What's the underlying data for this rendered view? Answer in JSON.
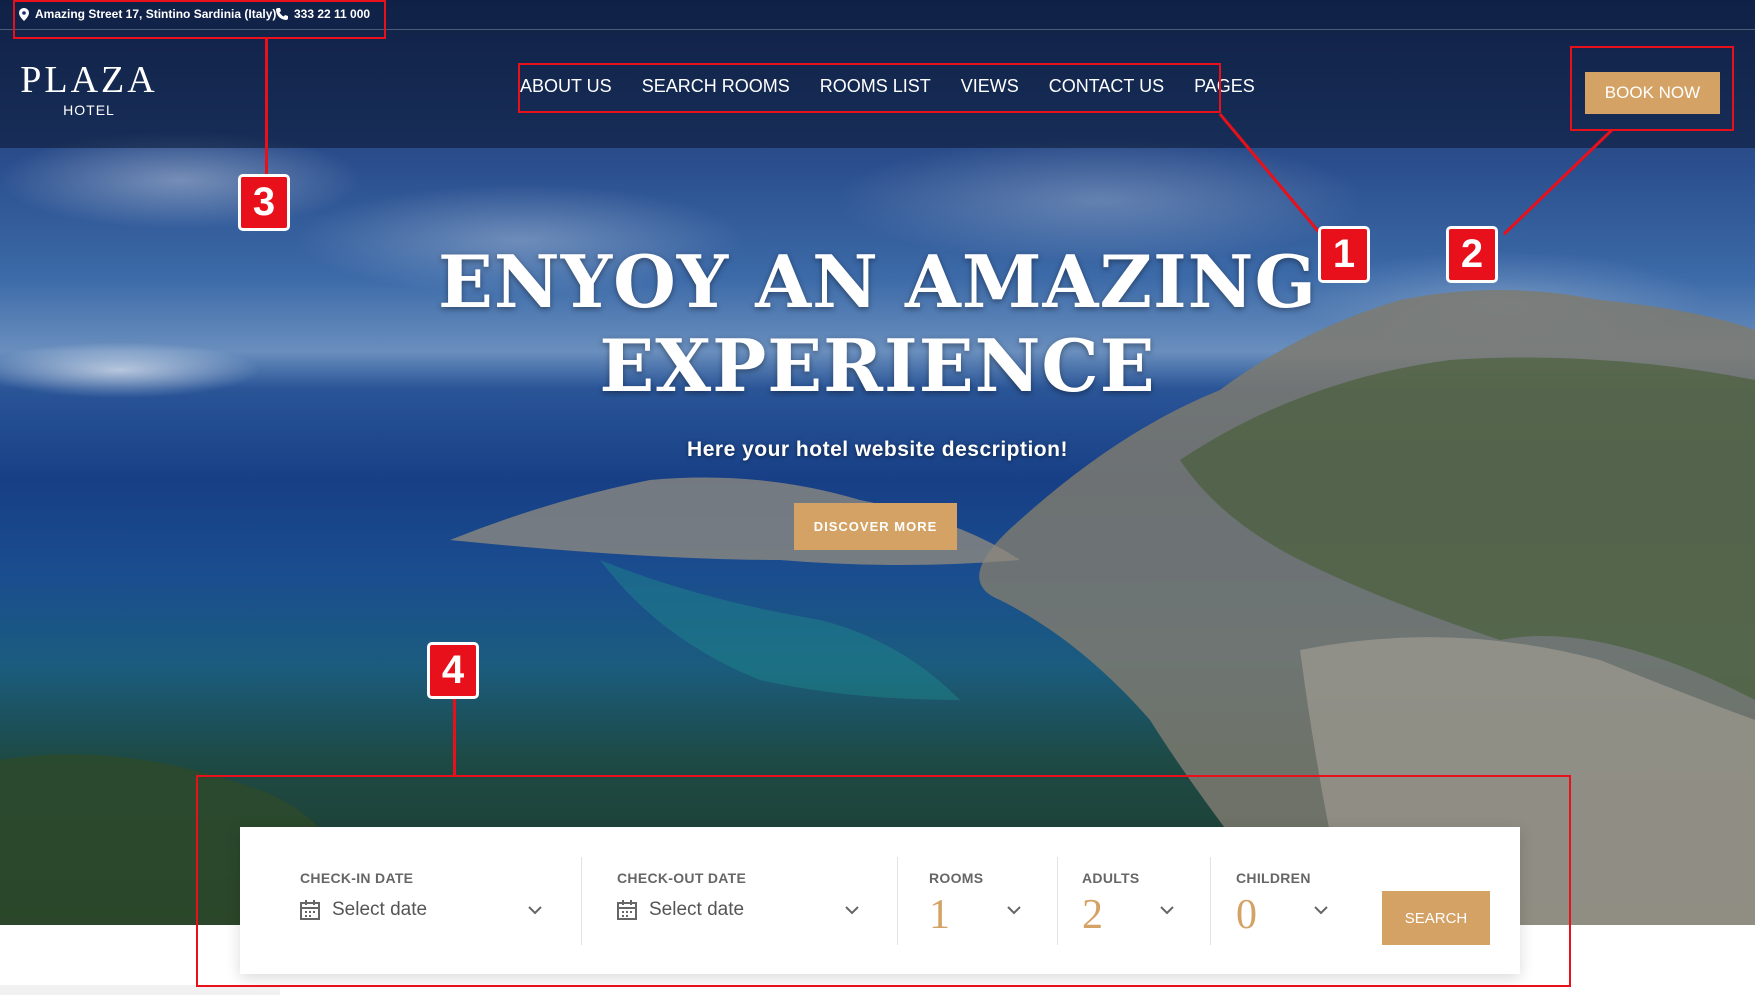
{
  "topbar": {
    "address": "Amazing Street 17, Stintino Sardinia (Italy)",
    "phone": "333 22 11 000"
  },
  "logo": {
    "name": "PLAZA",
    "sub": "HOTEL"
  },
  "nav": {
    "items": [
      "ABOUT US",
      "SEARCH ROOMS",
      "ROOMS LIST",
      "VIEWS",
      "CONTACT US",
      "PAGES"
    ]
  },
  "book_now_label": "BOOK NOW",
  "hero": {
    "headline_line1": "ENYOY AN AMAZING",
    "headline_line2": "EXPERIENCE",
    "subtitle": "Here your hotel website description!",
    "cta_label": "DISCOVER MORE"
  },
  "booking": {
    "checkin_label": "CHECK-IN DATE",
    "checkin_value": "Select date",
    "checkout_label": "CHECK-OUT DATE",
    "checkout_value": "Select date",
    "rooms_label": "ROOMS",
    "rooms_value": "1",
    "adults_label": "ADULTS",
    "adults_value": "2",
    "children_label": "CHILDREN",
    "children_value": "0",
    "search_label": "SEARCH"
  },
  "annotations": [
    "1",
    "2",
    "3",
    "4"
  ],
  "colors": {
    "accent": "#d4a265",
    "annotation": "#e8101a"
  }
}
